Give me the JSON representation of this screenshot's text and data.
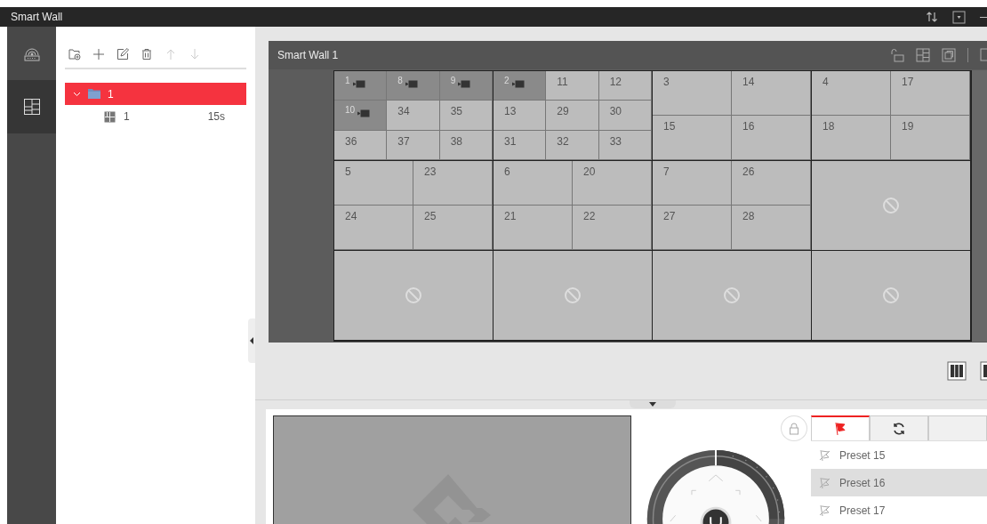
{
  "window": {
    "title": "Smart Wall"
  },
  "sidebar": {
    "items": [
      {
        "kind": "decoder",
        "selected": false
      },
      {
        "kind": "wall",
        "selected": true
      }
    ]
  },
  "tree_toolbar": [
    {
      "kind": "add-folder",
      "disabled": false
    },
    {
      "kind": "add",
      "disabled": false
    },
    {
      "kind": "edit",
      "disabled": false
    },
    {
      "kind": "delete",
      "disabled": false
    },
    {
      "kind": "up",
      "disabled": true
    },
    {
      "kind": "down",
      "disabled": true
    }
  ],
  "tree": {
    "items": [
      {
        "label": "1",
        "selected": true,
        "expanded": true,
        "children": [
          {
            "label": "1",
            "duration": "15s",
            "selected": false
          }
        ]
      }
    ]
  },
  "wall": {
    "title": "Smart Wall 1",
    "screens": [
      {
        "windows": [
          {
            "label": "1",
            "playing": true
          },
          {
            "label": "8",
            "playing": true
          },
          {
            "label": "9",
            "playing": true
          },
          {
            "label": "10",
            "playing": true
          },
          {
            "label": "34",
            "playing": false
          },
          {
            "label": "35",
            "playing": false
          },
          {
            "label": "36",
            "playing": false
          },
          {
            "label": "37",
            "playing": false
          },
          {
            "label": "38",
            "playing": false
          }
        ]
      },
      {
        "windows": [
          {
            "label": "2",
            "playing": true
          },
          {
            "label": "11",
            "playing": false
          },
          {
            "label": "12",
            "playing": false
          },
          {
            "label": "13",
            "playing": false
          },
          {
            "label": "29",
            "playing": false
          },
          {
            "label": "30",
            "playing": false
          },
          {
            "label": "31",
            "playing": false
          },
          {
            "label": "32",
            "playing": false
          },
          {
            "label": "33",
            "playing": false
          }
        ]
      },
      {
        "windows": [
          {
            "label": "3",
            "playing": false
          },
          {
            "label": "14",
            "playing": false
          },
          {
            "label": "15",
            "playing": false
          },
          {
            "label": "16",
            "playing": false
          }
        ]
      },
      {
        "windows": [
          {
            "label": "4",
            "playing": false
          },
          {
            "label": "17",
            "playing": false
          },
          {
            "label": "18",
            "playing": false
          },
          {
            "label": "19",
            "playing": false
          }
        ]
      },
      {
        "windows": [
          {
            "label": "5",
            "playing": false
          },
          {
            "label": "23",
            "playing": false
          },
          {
            "label": "24",
            "playing": false
          },
          {
            "label": "25",
            "playing": false
          }
        ]
      },
      {
        "windows": [
          {
            "label": "6",
            "playing": false
          },
          {
            "label": "20",
            "playing": false
          },
          {
            "label": "21",
            "playing": false
          },
          {
            "label": "22",
            "playing": false
          }
        ]
      },
      {
        "windows": [
          {
            "label": "7",
            "playing": false
          },
          {
            "label": "26",
            "playing": false
          },
          {
            "label": "27",
            "playing": false
          },
          {
            "label": "28",
            "playing": false
          }
        ]
      },
      {
        "kind": "empty"
      },
      {
        "kind": "empty"
      },
      {
        "kind": "empty"
      },
      {
        "kind": "empty"
      },
      {
        "kind": "empty"
      }
    ]
  },
  "presets": {
    "tabs": [
      {
        "kind": "preset",
        "selected": true
      },
      {
        "kind": "patrol",
        "selected": false
      },
      {
        "kind": "other",
        "selected": false
      }
    ],
    "items": [
      {
        "label": "Preset 15",
        "selected": false
      },
      {
        "label": "Preset 16",
        "selected": true
      },
      {
        "label": "Preset 17",
        "selected": false
      }
    ]
  }
}
